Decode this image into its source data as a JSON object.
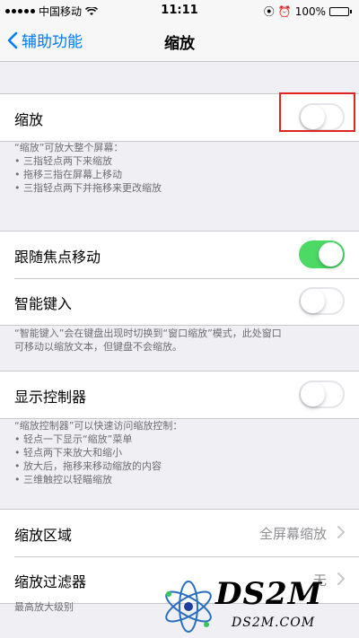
{
  "status_bar": {
    "carrier": "中国移动",
    "time": "11:11",
    "battery": "100%"
  },
  "nav": {
    "back_label": "辅助功能",
    "title": "缩放"
  },
  "zoom_section": {
    "label": "缩放",
    "toggle_on": false,
    "footer_title": "“缩放”可放大整个屏幕：",
    "footer_items": [
      "• 三指轻点两下来缩放",
      "• 拖移三指在屏幕上移动",
      "• 三指轻点两下并拖移来更改缩放"
    ]
  },
  "focus_section": {
    "follow_focus": {
      "label": "跟随焦点移动",
      "toggle_on": true
    },
    "smart_typing": {
      "label": "智能键入",
      "toggle_on": false
    },
    "footer_line1": "“智能键入”会在键盘出现时切换到“窗口缩放”模式，此处窗口",
    "footer_line2": "可移动以缩放文本，但键盘不会缩放。"
  },
  "controller_section": {
    "label": "显示控制器",
    "toggle_on": false,
    "footer_title": "“缩放控制器”可以快速访问缩放控制：",
    "footer_items": [
      "• 轻点一下显示“缩放”菜单",
      "• 轻点两下来放大和缩小",
      "• 放大后，拖移来移动缩放的内容",
      "• 三维触控以轻瞄缩放"
    ]
  },
  "region_section": {
    "zoom_region": {
      "label": "缩放区域",
      "value": "全屏幕缩放"
    },
    "zoom_filter": {
      "label": "缩放过滤器",
      "value": "无"
    }
  },
  "max_zoom_header": "最高放大级别",
  "watermark": {
    "main": "DS2M",
    "sub": "DS2M.COM"
  },
  "colors": {
    "accent": "#007aff",
    "toggle_on": "#4cd964",
    "highlight": "#e0241f"
  }
}
